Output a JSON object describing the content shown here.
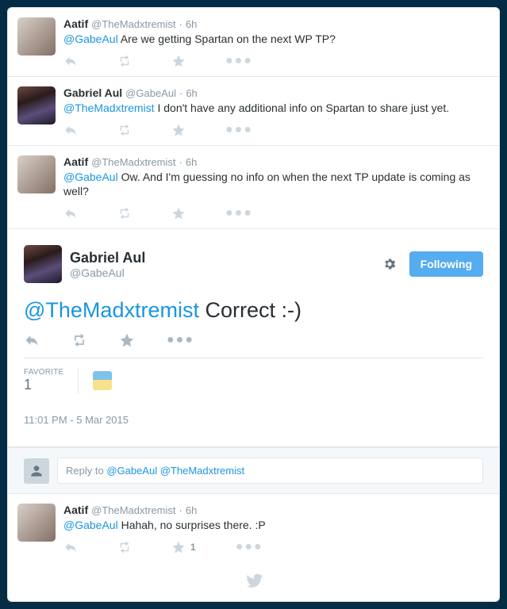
{
  "thread": [
    {
      "avatar_class": "kid",
      "display_name": "Aatif",
      "handle": "@TheMadxtremist",
      "time": "6h",
      "mention": "@GabeAul",
      "text": " Are we getting Spartan on the next WP TP?",
      "fav_count": ""
    },
    {
      "avatar_class": "gabe",
      "display_name": "Gabriel Aul",
      "handle": "@GabeAul",
      "time": "6h",
      "mention": "@TheMadxtremist",
      "text": " I don't have any additional info on Spartan to share just yet.",
      "fav_count": ""
    },
    {
      "avatar_class": "kid",
      "display_name": "Aatif",
      "handle": "@TheMadxtremist",
      "time": "6h",
      "mention": "@GabeAul",
      "text": " Ow. And I'm guessing no info on when the next TP update is coming as well?",
      "fav_count": ""
    }
  ],
  "main": {
    "avatar_class": "gabe",
    "display_name": "Gabriel Aul",
    "handle": "@GabeAul",
    "follow_label": "Following",
    "mention": "@TheMadxtremist",
    "text": " Correct :-)",
    "fav_label": "FAVORITE",
    "fav_count": "1",
    "timestamp": "11:01 PM - 5 Mar 2015"
  },
  "reply": {
    "placeholder_prefix": "Reply to ",
    "mention1": "@GabeAul",
    "mention2": "@TheMadxtremist"
  },
  "after": [
    {
      "avatar_class": "kid",
      "display_name": "Aatif",
      "handle": "@TheMadxtremist",
      "time": "6h",
      "mention": "@GabeAul",
      "text": " Hahah, no surprises there. :P",
      "fav_count": "1"
    }
  ]
}
